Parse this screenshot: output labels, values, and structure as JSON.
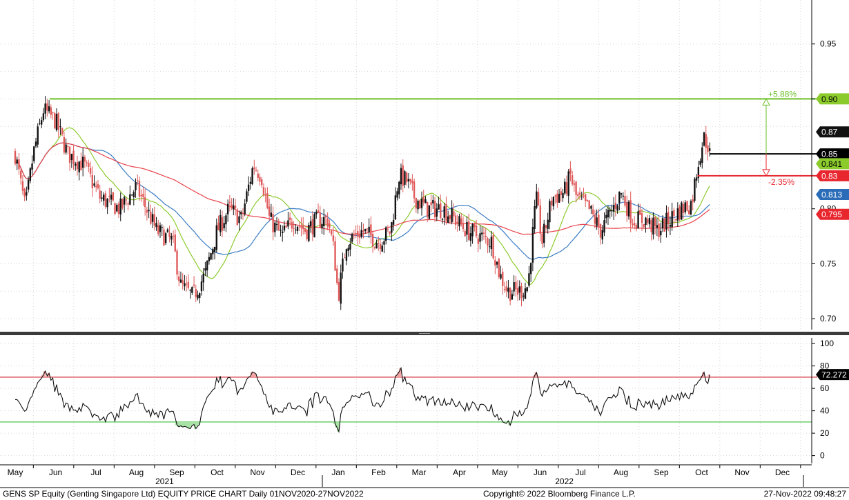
{
  "chart_data": [
    {
      "type": "candlestick",
      "panel": "price",
      "y_ticks": [
        {
          "label": "0.95",
          "value": 0.95
        },
        {
          "label": "0.90",
          "value": 0.9
        },
        {
          "label": "0.85",
          "value": 0.85
        },
        {
          "label": "0.80",
          "value": 0.8
        },
        {
          "label": "0.75",
          "value": 0.75
        },
        {
          "label": "0.70",
          "value": 0.7
        }
      ],
      "ylim": [
        0.69,
        0.99
      ],
      "grid": true,
      "up_color": "#111111",
      "down_color": "#e05a5a",
      "ohlc_anchors": [
        {
          "month": 0.0,
          "close": 0.85
        },
        {
          "month": 0.25,
          "close": 0.8
        },
        {
          "month": 0.45,
          "close": 0.85
        },
        {
          "month": 0.7,
          "close": 0.89
        },
        {
          "month": 1.0,
          "close": 0.88
        },
        {
          "month": 1.3,
          "close": 0.85
        },
        {
          "month": 1.7,
          "close": 0.84
        },
        {
          "month": 2.1,
          "close": 0.81
        },
        {
          "month": 2.6,
          "close": 0.8
        },
        {
          "month": 3.0,
          "close": 0.82
        },
        {
          "month": 3.5,
          "close": 0.78
        },
        {
          "month": 3.9,
          "close": 0.77
        },
        {
          "month": 4.1,
          "close": 0.73
        },
        {
          "month": 4.4,
          "close": 0.72
        },
        {
          "month": 4.7,
          "close": 0.74
        },
        {
          "month": 5.0,
          "close": 0.78
        },
        {
          "month": 5.3,
          "close": 0.8
        },
        {
          "month": 5.6,
          "close": 0.79
        },
        {
          "month": 5.9,
          "close": 0.84
        },
        {
          "month": 6.1,
          "close": 0.83
        },
        {
          "month": 6.3,
          "close": 0.79
        },
        {
          "month": 6.6,
          "close": 0.775
        },
        {
          "month": 6.9,
          "close": 0.79
        },
        {
          "month": 7.2,
          "close": 0.78
        },
        {
          "month": 7.5,
          "close": 0.79
        },
        {
          "month": 7.75,
          "close": 0.79
        },
        {
          "month": 7.9,
          "close": 0.76
        },
        {
          "month": 8.0,
          "close": 0.72
        },
        {
          "month": 8.2,
          "close": 0.77
        },
        {
          "month": 8.6,
          "close": 0.78
        },
        {
          "month": 9.0,
          "close": 0.77
        },
        {
          "month": 9.3,
          "close": 0.78
        },
        {
          "month": 9.5,
          "close": 0.83
        },
        {
          "month": 9.7,
          "close": 0.825
        },
        {
          "month": 9.9,
          "close": 0.81
        },
        {
          "month": 10.2,
          "close": 0.8
        },
        {
          "month": 10.6,
          "close": 0.8
        },
        {
          "month": 10.9,
          "close": 0.79
        },
        {
          "month": 11.2,
          "close": 0.78
        },
        {
          "month": 11.5,
          "close": 0.775
        },
        {
          "month": 11.8,
          "close": 0.77
        },
        {
          "month": 12.0,
          "close": 0.74
        },
        {
          "month": 12.2,
          "close": 0.725
        },
        {
          "month": 12.5,
          "close": 0.725
        },
        {
          "month": 12.7,
          "close": 0.73
        },
        {
          "month": 12.9,
          "close": 0.81
        },
        {
          "month": 13.05,
          "close": 0.77
        },
        {
          "month": 13.3,
          "close": 0.81
        },
        {
          "month": 13.6,
          "close": 0.815
        },
        {
          "month": 13.75,
          "close": 0.83
        },
        {
          "month": 13.9,
          "close": 0.81
        },
        {
          "month": 14.2,
          "close": 0.8
        },
        {
          "month": 14.5,
          "close": 0.78
        },
        {
          "month": 14.8,
          "close": 0.8
        },
        {
          "month": 15.0,
          "close": 0.815
        },
        {
          "month": 15.3,
          "close": 0.79
        },
        {
          "month": 15.6,
          "close": 0.79
        },
        {
          "month": 15.9,
          "close": 0.78
        },
        {
          "month": 16.2,
          "close": 0.79
        },
        {
          "month": 16.5,
          "close": 0.8
        },
        {
          "month": 16.75,
          "close": 0.805
        },
        {
          "month": 16.9,
          "close": 0.84
        },
        {
          "month": 17.05,
          "close": 0.865
        },
        {
          "month": 17.2,
          "close": 0.855
        }
      ],
      "overlays": [
        {
          "kind": "sma",
          "period": 20,
          "color": "#8ccb2c"
        },
        {
          "kind": "sma",
          "period": 40,
          "color": "#3a7cc4"
        },
        {
          "kind": "sma",
          "period": 100,
          "color": "#e8424a"
        }
      ],
      "reference_lines": [
        {
          "value": 0.9,
          "color": "#6abf24",
          "start_month": 0.85,
          "label": "0.90",
          "badge_bg": "#8ccb2c",
          "badge_fg": "#000000"
        },
        {
          "value": 0.85,
          "color": "#000000",
          "start_month": 17.2,
          "label": "0.85",
          "badge_bg": "#000000",
          "badge_fg": "#ffffff"
        },
        {
          "value": 0.83,
          "color": "#e8262e",
          "start_month": 16.9,
          "label": "0.83",
          "badge_bg": "#e8262e",
          "badge_fg": "#ffffff"
        }
      ],
      "last_price_badges": [
        {
          "label": "0.87",
          "value": 0.87,
          "bg": "#111111",
          "fg": "#ffffff"
        },
        {
          "label": "0.841",
          "value": 0.841,
          "bg": "#8ccb2c",
          "fg": "#000000"
        },
        {
          "label": "0.813",
          "value": 0.813,
          "bg": "#2a6cb8",
          "fg": "#ffffff"
        },
        {
          "label": "0.795",
          "value": 0.795,
          "bg": "#e8262e",
          "fg": "#ffffff"
        }
      ],
      "annotations": [
        {
          "text": "+5.88%",
          "color": "#6abf24",
          "from": 0.85,
          "to": 0.9
        },
        {
          "text": "-2.35%",
          "color": "#e8262e",
          "from": 0.85,
          "to": 0.83
        }
      ]
    },
    {
      "type": "line",
      "panel": "rsi",
      "y_ticks": [
        {
          "label": "100",
          "value": 100
        },
        {
          "label": "80",
          "value": 80
        },
        {
          "label": "60",
          "value": 60
        },
        {
          "label": "40",
          "value": 40
        },
        {
          "label": "20",
          "value": 20
        },
        {
          "label": "0",
          "value": 0
        }
      ],
      "ylim": [
        -7,
        105
      ],
      "overbought": 70,
      "oversold": 30,
      "overbought_color": "#d4303a",
      "oversold_color": "#4cc24a",
      "last_value": 72.272,
      "last_label": "72.272",
      "badge_bg": "#000000",
      "badge_fg": "#ffffff"
    }
  ],
  "x_axis": {
    "months": [
      "May",
      "Jun",
      "Jul",
      "Aug",
      "Sep",
      "Oct",
      "Nov",
      "Dec",
      "Jan",
      "Feb",
      "Mar",
      "Apr",
      "May",
      "Jun",
      "Jul",
      "Aug",
      "Sep",
      "Oct",
      "Nov",
      "Dec"
    ],
    "years": [
      {
        "label": "2021",
        "month_index": 3.7
      },
      {
        "label": "2022",
        "month_index": 13.6
      }
    ]
  },
  "footer": {
    "left": "GENS SP Equity (Genting Singapore Ltd) EQUITY PRICE CHART  Daily 01NOV2020-27NOV2022",
    "center": "Copyright© 2022 Bloomberg Finance L.P.",
    "right": "27-Nov-2022 09:48:27"
  }
}
